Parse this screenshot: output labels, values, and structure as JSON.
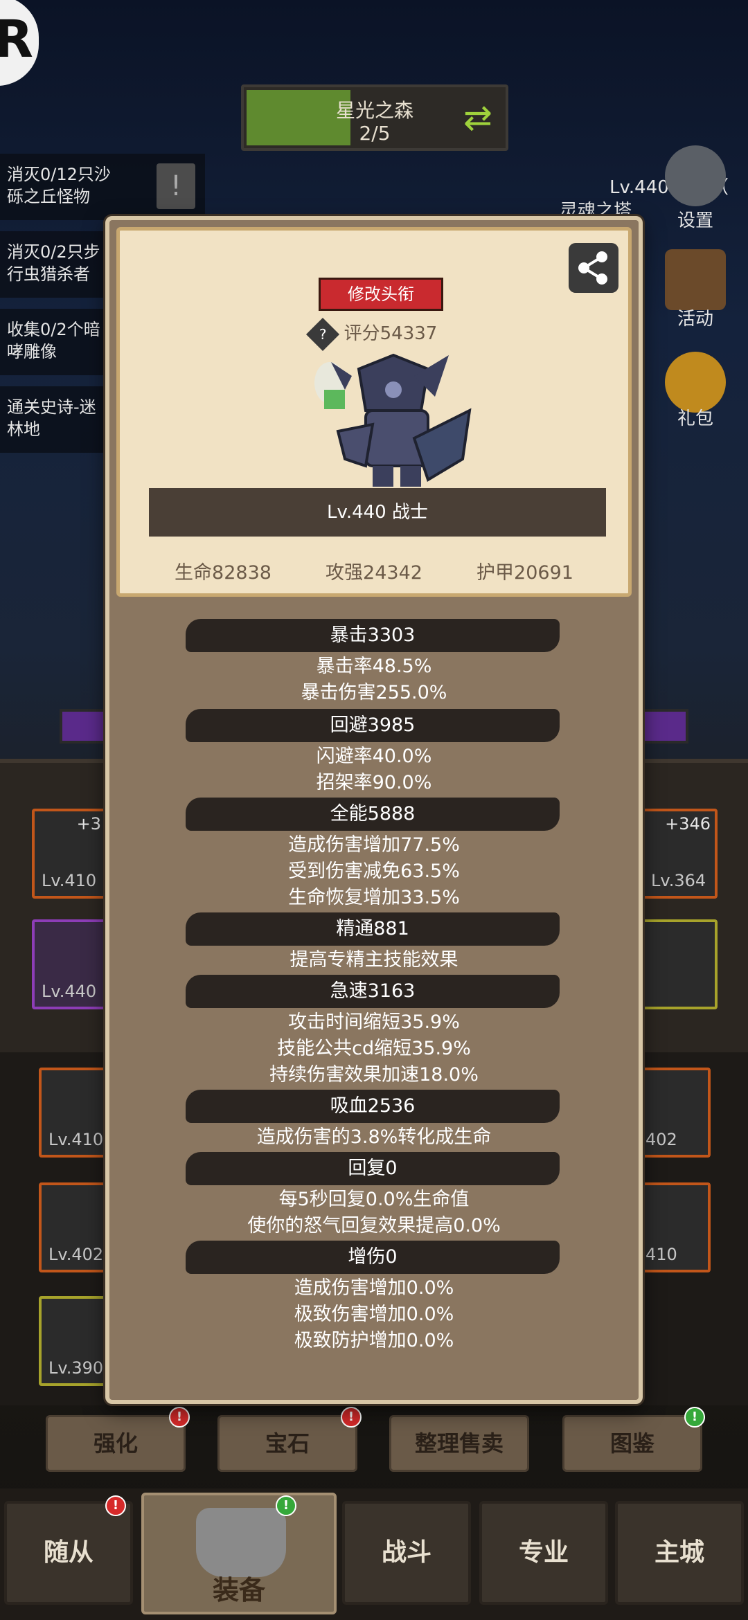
{
  "zone": {
    "name": "星光之森",
    "progress": "2/5",
    "progress_fraction": 0.4
  },
  "quests": [
    {
      "line1": "消灭0/12只沙",
      "line2": "砾之丘怪物"
    },
    {
      "line1": "消灭0/2只步",
      "line2": "行虫猎杀者"
    },
    {
      "line1": "收集0/2个暗",
      "line2": "哮雕像"
    },
    {
      "line1": "通关史诗-迷",
      "line2": "林地"
    }
  ],
  "right_menu": {
    "top_text": "Lv.440 盗贼（",
    "soul_tower": "灵魂之塔",
    "settings": "设置",
    "activity": "活动",
    "gift": "礼包"
  },
  "equipment": [
    {
      "level": "Lv.410",
      "plus": "+3"
    },
    {
      "level": "Lv.440",
      "plus": ""
    },
    {
      "level": "Lv.364",
      "plus": "+346"
    },
    {
      "level": "Lv.410",
      "plus": ""
    },
    {
      "level": "Lv.402",
      "plus": ""
    },
    {
      "level": "Lv.390",
      "plus": ""
    },
    {
      "level": "402",
      "plus": ""
    },
    {
      "level": "410",
      "plus": ""
    }
  ],
  "actions": [
    "强化",
    "宝石",
    "整理售卖",
    "图鉴"
  ],
  "nav": {
    "follower": "随从",
    "equip": "装备",
    "battle": "战斗",
    "profession": "专业",
    "city": "主城"
  },
  "popup": {
    "title_button": "修改头衔",
    "score_label": "评分54337",
    "score_icon": "?",
    "char_label": "Lv.440 战士",
    "hp": "生命82838",
    "atk": "攻强24342",
    "armor": "护甲20691",
    "sections": [
      {
        "header": "暴击3303",
        "lines": [
          "暴击率48.5%",
          "暴击伤害255.0%"
        ]
      },
      {
        "header": "回避3985",
        "lines": [
          "闪避率40.0%",
          "招架率90.0%"
        ]
      },
      {
        "header": "全能5888",
        "lines": [
          "造成伤害增加77.5%",
          "受到伤害减免63.5%",
          "生命恢复增加33.5%"
        ]
      },
      {
        "header": "精通881",
        "lines": [
          "提高专精主技能效果"
        ]
      },
      {
        "header": "急速3163",
        "lines": [
          "攻击时间缩短35.9%",
          "技能公共cd缩短35.9%",
          "持续伤害效果加速18.0%"
        ]
      },
      {
        "header": "吸血2536",
        "lines": [
          "造成伤害的3.8%转化成生命"
        ]
      },
      {
        "header": "回复0",
        "lines": [
          "每5秒回复0.0%生命值",
          "使你的怒气回复效果提高0.0%"
        ]
      },
      {
        "header": "增伤0",
        "lines": [
          "造成伤害增加0.0%",
          "极致伤害增加0.0%",
          "极致防护增加0.0%"
        ]
      }
    ]
  },
  "colors": {
    "popup_bg": "#8a7660",
    "profile_bg": "#f1e2c4",
    "title_red": "#c92a2f",
    "header_dark": "#2a2420",
    "zone_green": "#5f8a2f"
  }
}
